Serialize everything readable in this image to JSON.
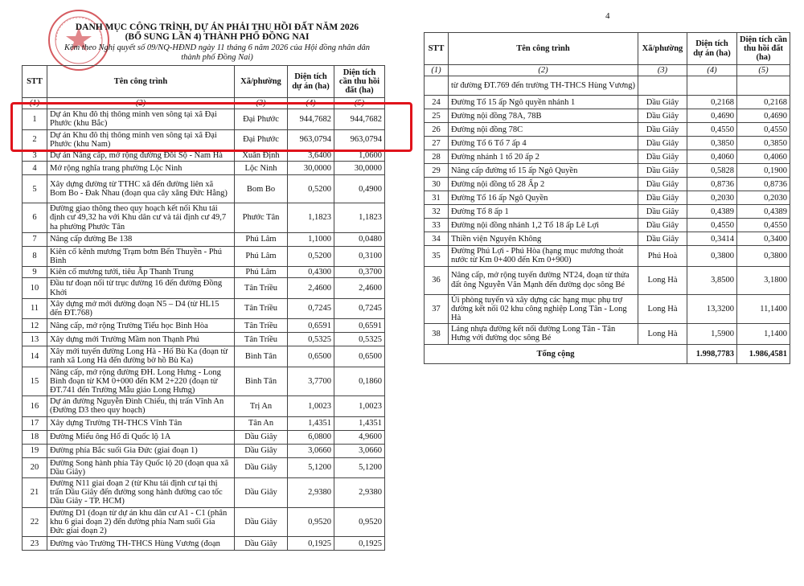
{
  "page_number": "4",
  "header": {
    "title_line1": "DANH MỤC CÔNG TRÌNH, DỰ ÁN PHẢI THU HỒI ĐẤT NĂM 2026",
    "title_line2": "(BỔ SUNG LẦN 4) THÀNH PHỐ ĐỒNG NAI",
    "subtitle_line1": "Kèm theo Nghị quyết số 09/NQ-HĐND ngày 11 tháng 6 năm 2026 của Hội đồng nhân dân",
    "subtitle_line2": "thành phố Đồng Nai)",
    "seal_text": "HỘI ĐỒNG NHÂN DÂN THÀNH PHỐ ĐỒNG NAI"
  },
  "columns": {
    "stt": "STT",
    "name": "Tên công trình",
    "ward": "Xã/phường",
    "area": "Diện tích dự án (ha)",
    "reclaim": "Diện tích cần thu hồi đất (ha)"
  },
  "column_index": [
    "(1)",
    "(2)",
    "(3)",
    "(4)",
    "(5)"
  ],
  "left_rows": [
    {
      "stt": "1",
      "name": "Dự án Khu đô thị thông minh ven sông tại xã Đại Phước (khu Bắc)",
      "ward": "Đại Phước",
      "area": "944,7682",
      "reclaim": "944,7682"
    },
    {
      "stt": "2",
      "name": "Dự án Khu đô thị thông minh ven sông tại xã Đại Phước (khu Nam)",
      "ward": "Đại Phước",
      "area": "963,0794",
      "reclaim": "963,0794"
    },
    {
      "stt": "3",
      "name": "Dự án Nâng cấp, mở rộng đường Đồi Sộ - Nam Hà",
      "ward": "Xuân Định",
      "area": "3,6400",
      "reclaim": "1,0600"
    },
    {
      "stt": "4",
      "name": "Mở rộng nghĩa trang phường Lộc Ninh",
      "ward": "Lộc Ninh",
      "area": "30,0000",
      "reclaim": "30,0000"
    },
    {
      "stt": "5",
      "name": "Xây dựng đường từ TTHC xã đến đường liên xã Bom Bo - Đak Nhau (đoạn qua cây xăng Đức Hằng)",
      "ward": "Bom Bo",
      "area": "0,5200",
      "reclaim": "0,4900"
    },
    {
      "stt": "6",
      "name": "Đường giao thông theo quy hoạch kết nối Khu tái định cư 49,32 ha với Khu dân cư và tái định cư 49,7 ha phường Phước Tân",
      "ward": "Phước Tân",
      "area": "1,1823",
      "reclaim": "1,1823"
    },
    {
      "stt": "7",
      "name": "Nâng cấp đường Be 138",
      "ward": "Phú Lâm",
      "area": "1,1000",
      "reclaim": "0,0480"
    },
    {
      "stt": "8",
      "name": "Kiên cố kênh mương Trạm bơm Bến Thuyền - Phú Bình",
      "ward": "Phú Lâm",
      "area": "0,5200",
      "reclaim": "0,3100"
    },
    {
      "stt": "9",
      "name": "Kiên cố mương tưới, tiêu Ấp Thanh Trung",
      "ward": "Phú Lâm",
      "area": "0,4300",
      "reclaim": "0,3700"
    },
    {
      "stt": "10",
      "name": "Đầu tư đoạn nối từ trục đường 16 đến đường Đồng Khởi",
      "ward": "Tân Triều",
      "area": "2,4600",
      "reclaim": "2,4600"
    },
    {
      "stt": "11",
      "name": "Xây dựng mở mới đường đoạn N5 – D4 (từ HL15 đến ĐT.768)",
      "ward": "Tân Triều",
      "area": "0,7245",
      "reclaim": "0,7245"
    },
    {
      "stt": "12",
      "name": "Nâng cấp, mở rộng Trường Tiểu học Bình Hòa",
      "ward": "Tân Triều",
      "area": "0,6591",
      "reclaim": "0,6591"
    },
    {
      "stt": "13",
      "name": "Xây dựng mới Trường Mầm non Thạnh Phú",
      "ward": "Tân Triều",
      "area": "0,5325",
      "reclaim": "0,5325"
    },
    {
      "stt": "14",
      "name": "Xây mới tuyến đường Long Hà - Hố Bù Ka (đoạn từ ranh xã Long Hà đến đường bờ hồ Bù Ka)",
      "ward": "Bình Tân",
      "area": "0,6500",
      "reclaim": "0,6500"
    },
    {
      "stt": "15",
      "name": "Nâng cấp, mở rộng đường ĐH. Long Hưng - Long Bình đoạn từ KM 0+000 đến KM 2+220 (đoạn từ ĐT.741 đến Trường Mẫu giáo Long Hưng)",
      "ward": "Bình Tân",
      "area": "3,7700",
      "reclaim": "0,1860"
    },
    {
      "stt": "16",
      "name": "Dự án đường Nguyễn Đình Chiểu, thị trấn Vĩnh An (Đường D3 theo quy hoạch)",
      "ward": "Trị An",
      "area": "1,0023",
      "reclaim": "1,0023"
    },
    {
      "stt": "17",
      "name": "Xây dựng Trường TH-THCS Vĩnh Tân",
      "ward": "Tân An",
      "area": "1,4351",
      "reclaim": "1,4351"
    },
    {
      "stt": "18",
      "name": "Đường Miếu ông Hổ đi Quốc lộ 1A",
      "ward": "Dầu Giây",
      "area": "6,0800",
      "reclaim": "4,9600"
    },
    {
      "stt": "19",
      "name": "Đường phía Bắc suối Gia Đức (giai đoạn 1)",
      "ward": "Dầu Giây",
      "area": "3,0660",
      "reclaim": "3,0660"
    },
    {
      "stt": "20",
      "name": "Đường Song hành phía Tây Quốc lộ 20 (đoạn qua xã Dầu Giây)",
      "ward": "Dầu Giây",
      "area": "5,1200",
      "reclaim": "5,1200"
    },
    {
      "stt": "21",
      "name": "Đường N11 giai đoạn 2 (từ Khu tái định cư tại thị trấn Dầu Giây đến đường song hành đường cao tốc Dầu Giây - TP. HCM)",
      "ward": "Dầu Giây",
      "area": "2,9380",
      "reclaim": "2,9380"
    },
    {
      "stt": "22",
      "name": "Đường D1 (đoạn từ dự án khu dân cư A1 - C1 (phân khu 6 giai đoạn 2) đến đường phía Nam suối Gia Đức giai đoạn 2)",
      "ward": "Dầu Giây",
      "area": "0,9520",
      "reclaim": "0,9520"
    },
    {
      "stt": "23",
      "name": "Đường vào Trường TH-THCS Hùng Vương (đoạn",
      "ward": "Dầu Giây",
      "area": "0,1925",
      "reclaim": "0,1925"
    }
  ],
  "right_continuation": "từ đường ĐT.769 đến trường TH-THCS Hùng Vương)",
  "right_rows": [
    {
      "stt": "24",
      "name": "Đường Tổ 15 ấp Ngô quyền nhánh 1",
      "ward": "Dầu Giây",
      "area": "0,2168",
      "reclaim": "0,2168"
    },
    {
      "stt": "25",
      "name": "Đường nội đồng 78A, 78B",
      "ward": "Dầu Giây",
      "area": "0,4690",
      "reclaim": "0,4690"
    },
    {
      "stt": "26",
      "name": "Đường nội đồng 78C",
      "ward": "Dầu Giây",
      "area": "0,4550",
      "reclaim": "0,4550"
    },
    {
      "stt": "27",
      "name": "Đường Tổ 6 Tổ 7 ấp 4",
      "ward": "Dầu Giây",
      "area": "0,3850",
      "reclaim": "0,3850"
    },
    {
      "stt": "28",
      "name": "Đường nhánh 1 tổ 20 ấp 2",
      "ward": "Dầu Giây",
      "area": "0,4060",
      "reclaim": "0,4060"
    },
    {
      "stt": "29",
      "name": "Nâng cấp đường tổ 15 ấp Ngô Quyền",
      "ward": "Dầu Giây",
      "area": "0,5828",
      "reclaim": "0,1900"
    },
    {
      "stt": "30",
      "name": "Đường nội đồng tổ 28 Ấp 2",
      "ward": "Dầu Giây",
      "area": "0,8736",
      "reclaim": "0,8736"
    },
    {
      "stt": "31",
      "name": "Đường Tổ 16 ấp Ngô Quyền",
      "ward": "Dầu Giây",
      "area": "0,2030",
      "reclaim": "0,2030"
    },
    {
      "stt": "32",
      "name": "Đường Tổ 8 ấp 1",
      "ward": "Dầu Giây",
      "area": "0,4389",
      "reclaim": "0,4389"
    },
    {
      "stt": "33",
      "name": "Đường nội đồng nhánh 1,2 Tổ 18 ấp Lê Lợi",
      "ward": "Dầu Giây",
      "area": "0,4550",
      "reclaim": "0,4550"
    },
    {
      "stt": "34",
      "name": "Thiền viện Nguyên Không",
      "ward": "Dầu Giây",
      "area": "0,3414",
      "reclaim": "0,3400"
    },
    {
      "stt": "35",
      "name": "Đường Phú Lợi - Phú Hòa (hạng mục mương thoát nước từ Km 0+400 đến Km 0+900)",
      "ward": "Phú Hoà",
      "area": "0,3800",
      "reclaim": "0,3800"
    },
    {
      "stt": "36",
      "name": "Nâng cấp, mở rộng tuyến đường NT24, đoạn từ thửa đất ông Nguyễn Văn Mạnh đến đường dọc sông Bé",
      "ward": "Long Hà",
      "area": "3,8500",
      "reclaim": "3,1800"
    },
    {
      "stt": "37",
      "name": "Ủi phòng tuyến và xây dựng các hạng mục phụ trợ đường kết nối 02 khu công nghiệp Long Tân - Long Hà",
      "ward": "Long Hà",
      "area": "13,3200",
      "reclaim": "11,1400"
    },
    {
      "stt": "38",
      "name": "Láng nhựa đường kết nối đường Long Tân - Tân Hưng với đường dọc sông Bé",
      "ward": "Long Hà",
      "area": "1,5900",
      "reclaim": "1,1400"
    }
  ],
  "total": {
    "label": "Tổng cộng",
    "area": "1.998,7783",
    "reclaim": "1.986,4581"
  },
  "colors": {
    "highlight": "#e0131b",
    "seal": "#c8242b"
  }
}
